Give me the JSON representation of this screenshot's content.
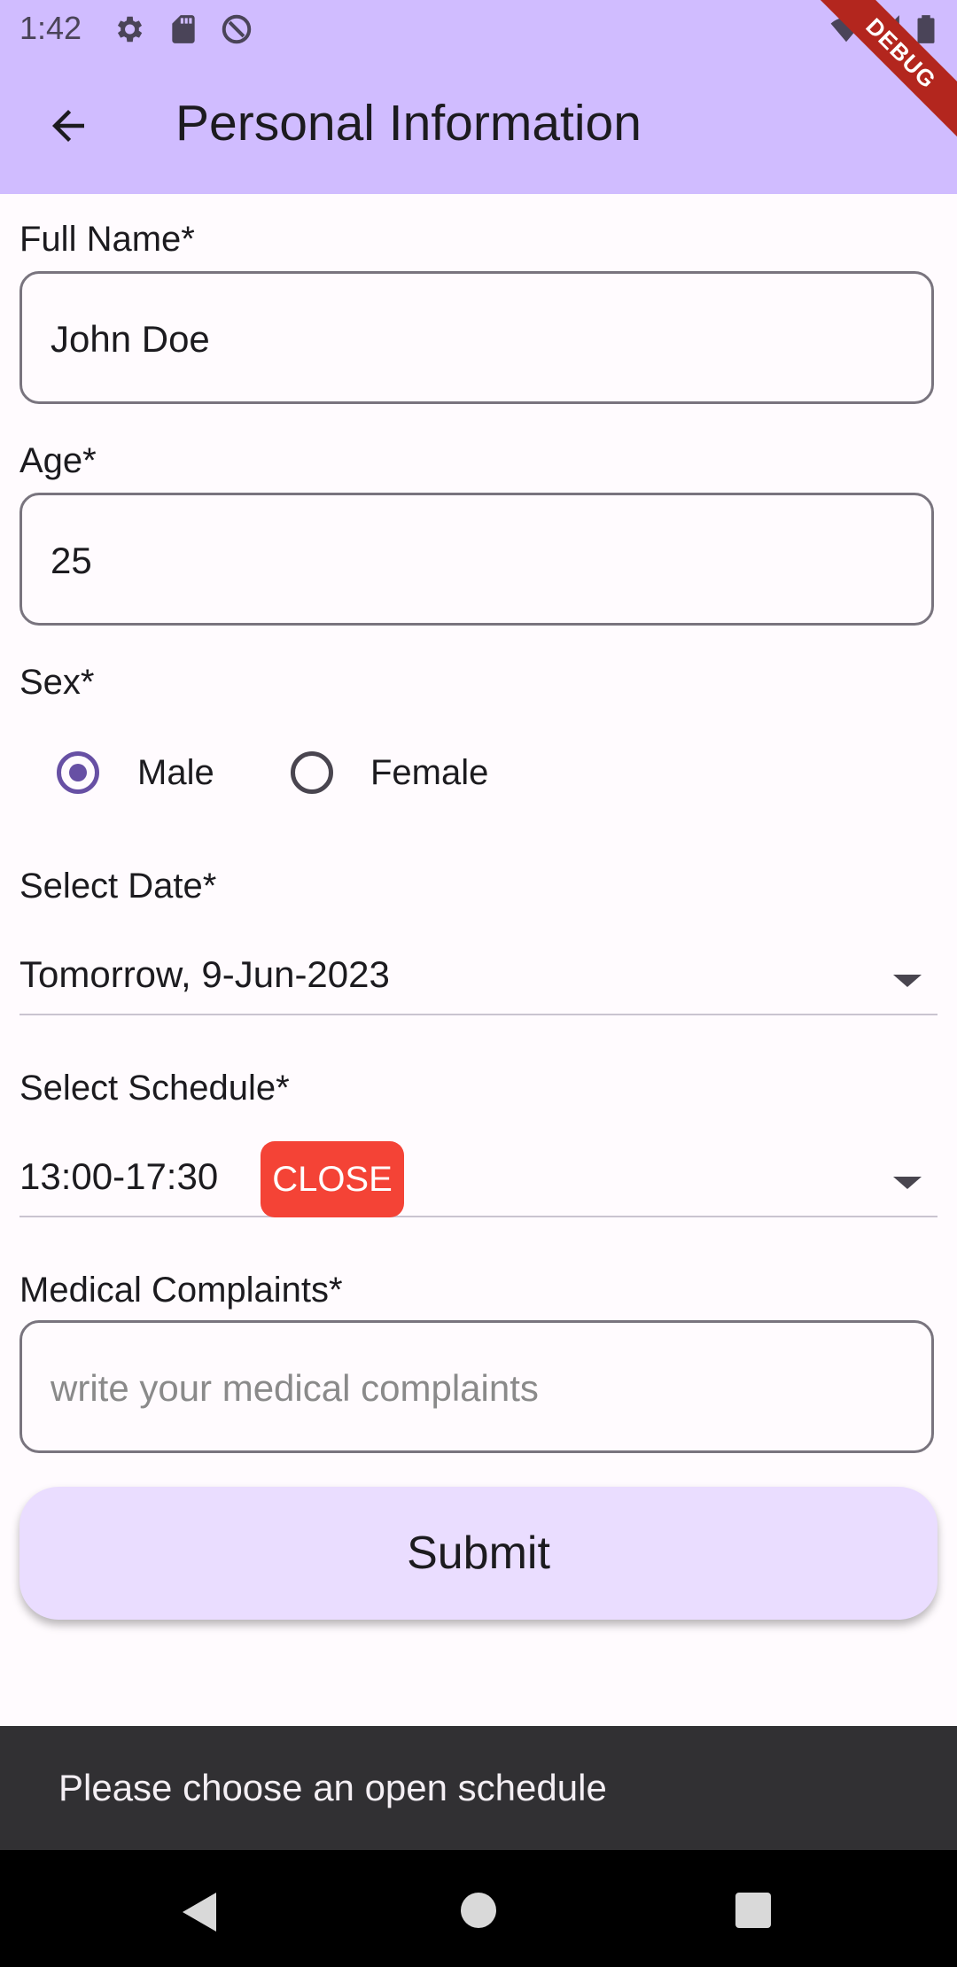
{
  "status_bar": {
    "time": "1:42"
  },
  "app_bar": {
    "title": "Personal Information",
    "debug_banner": "DEBUG"
  },
  "form": {
    "full_name": {
      "label": "Full Name*",
      "value": "John Doe"
    },
    "age": {
      "label": "Age*",
      "value": "25"
    },
    "sex": {
      "label": "Sex*",
      "options": [
        {
          "label": "Male",
          "selected": true
        },
        {
          "label": "Female",
          "selected": false
        }
      ]
    },
    "date": {
      "label": "Select Date*",
      "value": "Tomorrow, 9-Jun-2023"
    },
    "schedule": {
      "label": "Select Schedule*",
      "value": "13:00-17:30",
      "status_badge": "CLOSE",
      "badge_color": "#f44336"
    },
    "complaints": {
      "label": "Medical Complaints*",
      "placeholder": "write your medical complaints"
    },
    "submit_label": "Submit"
  },
  "snackbar": {
    "message": "Please choose an open schedule"
  },
  "colors": {
    "app_bar": "#d0bcff",
    "accent": "#6750a4",
    "button": "#eaddff",
    "snackbar": "#313033"
  }
}
